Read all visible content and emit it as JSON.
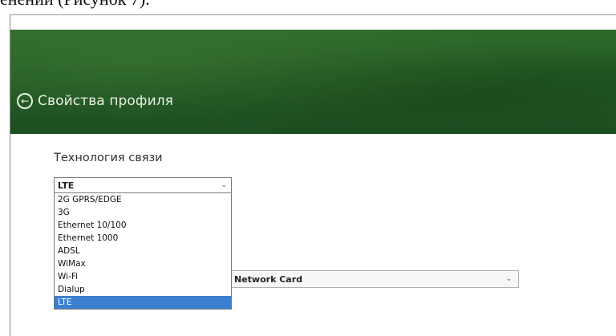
{
  "document": {
    "caption": "енений (Рисунок 7)."
  },
  "header": {
    "back_icon": "back-arrow-circle-icon",
    "title": "Свойства профиля"
  },
  "form": {
    "technology_label": "Технология связи",
    "technology_select": {
      "value": "LTE",
      "options": [
        "2G GPRS/EDGE",
        "3G",
        "Ethernet 10/100",
        "Ethernet 1000",
        "ADSL",
        "WiMax",
        "Wi-Fi",
        "Dialup",
        "LTE"
      ],
      "selected_index": 8
    },
    "adapter_select": {
      "value_visible": "Network Card"
    }
  },
  "colors": {
    "header_green": "#245a25",
    "selection_blue": "#3b7fd1"
  }
}
